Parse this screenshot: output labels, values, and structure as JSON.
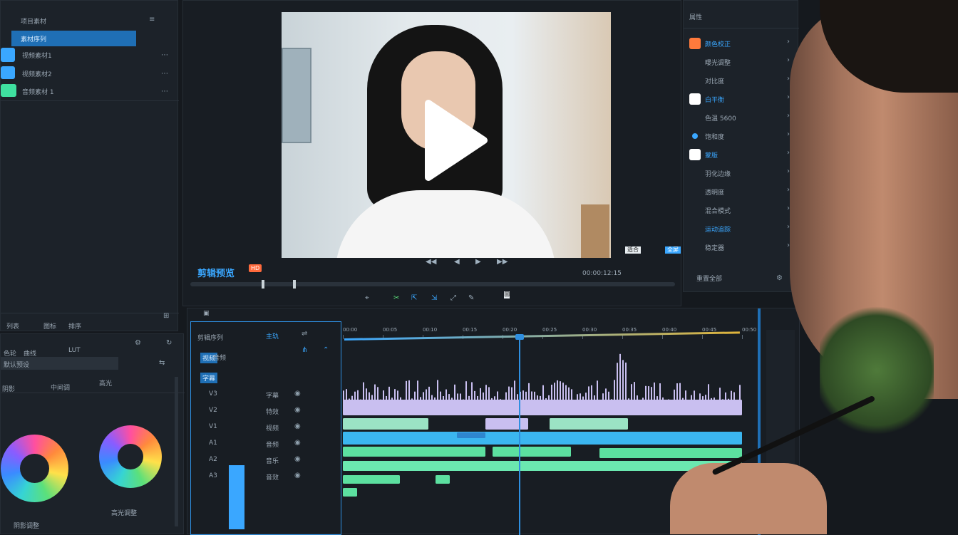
{
  "project_panel": {
    "title": "项目素材",
    "items": [
      {
        "label": "素材序列",
        "swatch": "#2f8fe0",
        "selected": true
      },
      {
        "label": "视频素材1",
        "swatch": "#3aa7ff"
      },
      {
        "label": "视频素材2",
        "swatch": "#3aa7ff"
      },
      {
        "label": "音频素材 1",
        "swatch": "#3fe0a0"
      }
    ],
    "footer": [
      "列表",
      "图标",
      "排序"
    ]
  },
  "viewer": {
    "title": "剪辑预览",
    "badge": "HD",
    "controls": [
      "◀◀",
      "◀",
      "▶",
      "▶▶",
      "⏹",
      "⏏"
    ],
    "timecode": "00:00:12:15",
    "toolbar": [
      "⌖",
      "✂",
      "⇱",
      "⇲",
      "⤢",
      "✎",
      "⊞",
      "⊟",
      "⊠"
    ],
    "fit": "适合",
    "full": "全屏"
  },
  "inspector": {
    "title": "属性",
    "items": [
      {
        "label": "颜色校正",
        "swatch": "#ff7a3c",
        "highlight": true
      },
      {
        "label": "曝光调整"
      },
      {
        "label": "对比度"
      },
      {
        "label": "白平衡",
        "swatch": "#ffffff",
        "highlight": true
      },
      {
        "label": "色温 5600"
      },
      {
        "label": "饱和度",
        "dot": "#3aa7ff"
      },
      {
        "label": "蒙版",
        "swatch": "#ffffff",
        "highlight": true
      },
      {
        "label": "羽化边缘"
      },
      {
        "label": "透明度"
      },
      {
        "label": "混合模式"
      },
      {
        "label": "运动追踪",
        "highlight": true
      },
      {
        "label": "稳定器"
      }
    ],
    "footer": "重置全部"
  },
  "color_panel": {
    "tabs": [
      "色轮",
      "曲线",
      "LUT"
    ],
    "preset": "默认预设",
    "wheels": [
      "阴影",
      "中间调",
      "高光"
    ],
    "wheel_labels": [
      "阴影调整",
      "高光调整"
    ]
  },
  "timeline": {
    "sequence_title": "剪辑序列",
    "tab2": "主轨",
    "header_labels": [
      "视频",
      "音频",
      "字幕"
    ],
    "time_marks": [
      "00:00",
      "00:05",
      "00:10",
      "00:15",
      "00:20",
      "00:25",
      "00:30",
      "00:35",
      "00:40",
      "00:45",
      "00:50"
    ],
    "tracks": [
      {
        "name": "V3",
        "label": "字幕",
        "icon": "T"
      },
      {
        "name": "V2",
        "label": "特效"
      },
      {
        "name": "V1",
        "label": "视频",
        "icon": "⌁"
      },
      {
        "name": "A1",
        "label": "音频",
        "icon": "♪"
      },
      {
        "name": "A2",
        "label": "音乐",
        "icon": "♫"
      },
      {
        "name": "A3",
        "label": "音效",
        "icon": "♬"
      }
    ],
    "playhead_time": "00:00:12:15"
  },
  "colors": {
    "accent": "#2f8fe0",
    "lavender": "#c9bff0",
    "sky": "#3bb6f0",
    "green": "#5ce0a0",
    "gold": "#e0b43a"
  }
}
